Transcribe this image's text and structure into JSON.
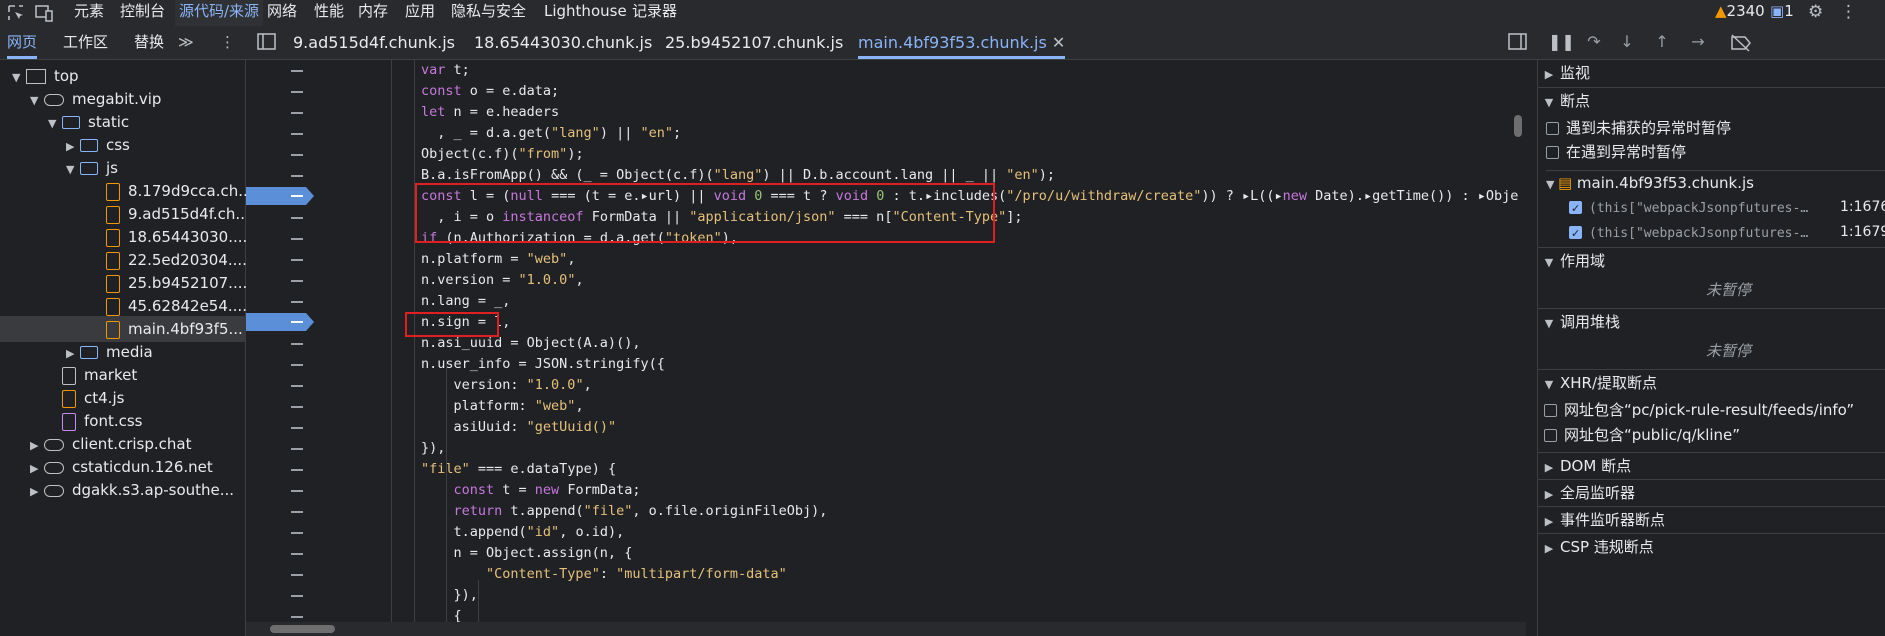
{
  "topbar": {
    "tabs": [
      "元素",
      "控制台",
      "源代码/来源",
      "网络",
      "性能",
      "内存",
      "应用",
      "隐私与安全",
      "Lighthouse",
      "记录器"
    ],
    "issues_count": "2340",
    "messages_count": "1"
  },
  "navigator": {
    "tabs": [
      "网页",
      "工作区",
      "替换"
    ],
    "more": "≫",
    "menu": "⋮"
  },
  "editor_tabs": [
    "9.ad515d4f.chunk.js",
    "18.65443030.chunk.js",
    "25.b9452107.chunk.js",
    "main.4bf93f53.chunk.js"
  ],
  "tree": [
    {
      "label": "top",
      "type": "frame",
      "arrow": "▼"
    },
    {
      "label": "megabit.vip",
      "type": "cloud",
      "arrow": "▼"
    },
    {
      "label": "static",
      "type": "folder",
      "arrow": "▼"
    },
    {
      "label": "css",
      "type": "folder",
      "arrow": "▶"
    },
    {
      "label": "js",
      "type": "folder",
      "arrow": "▼"
    },
    {
      "label": "8.179d9cca.ch...",
      "type": "file"
    },
    {
      "label": "9.ad515d4f.ch...",
      "type": "file"
    },
    {
      "label": "18.65443030....",
      "type": "file"
    },
    {
      "label": "22.5ed20304....",
      "type": "file"
    },
    {
      "label": "25.b9452107....",
      "type": "file"
    },
    {
      "label": "45.62842e54....",
      "type": "file"
    },
    {
      "label": "main.4bf93f5...",
      "type": "file"
    },
    {
      "label": "media",
      "type": "folder",
      "arrow": "▶"
    },
    {
      "label": "market",
      "type": "filegray"
    },
    {
      "label": "ct4.js",
      "type": "file"
    },
    {
      "label": "font.css",
      "type": "css"
    },
    {
      "label": "client.crisp.chat",
      "type": "cloud",
      "arrow": "▶"
    },
    {
      "label": "cstaticdun.126.net",
      "type": "cloud",
      "arrow": "▶"
    },
    {
      "label": "dgakk.s3.ap-southe...",
      "type": "cloud",
      "arrow": "▶"
    }
  ],
  "code_lines": [
    "var t;",
    "const o = e.data;",
    "let n = e.headers",
    "  , _ = d.a.get(\"lang\") || \"en\";",
    "Object(c.f)(\"from\");",
    "B.a.isFromApp() && (_ = Object(c.f)(\"lang\") || D.b.account.lang || _ || \"en\");",
    "const l = (null === (t = e.▸url) || void 0 === t ? void 0 : t.▸includes(\"/pro/u/withdraw/create\")) ? ▸L((▸new Date).▸getTime()) : ▸Obje",
    "  , i = o instanceof FormData || \"application/json\" === n[\"Content-Type\"];",
    "if (n.Authorization = d.a.get(\"token\"),",
    "n.platform = \"web\",",
    "n.version = \"1.0.0\",",
    "n.lang = _,",
    "n.sign = l,",
    "n.asi_uuid = Object(A.a)(),",
    "n.user_info = JSON.stringify({",
    "    version: \"1.0.0\",",
    "    platform: \"web\",",
    "    asiUuid: \"getUuid()\"",
    "}),",
    "\"file\" === e.dataType) {",
    "    const t = new FormData;",
    "    return t.append(\"file\", o.file.originFileObj),",
    "    t.append(\"id\", o.id),",
    "    n = Object.assign(n, {",
    "        \"Content-Type\": \"multipart/form-data\"",
    "    }),",
    "    {"
  ],
  "debugger": {
    "watch": "监视",
    "breakpoints": "断点",
    "pause_uncaught": "遇到未捕获的异常时暂停",
    "pause_caught": "在遇到异常时暂停",
    "bp_file": "main.4bf93f53.chunk.js",
    "bp_items": [
      {
        "code": "(this[\"webpackJsonpfutures-…",
        "line": "1:1676"
      },
      {
        "code": "(this[\"webpackJsonpfutures-…",
        "line": "1:1679"
      }
    ],
    "scope": "作用域",
    "scope_status": "未暂停",
    "callstack": "调用堆栈",
    "callstack_status": "未暂停",
    "xhr": "XHR/提取断点",
    "xhr_items": [
      "网址包含“pc/pick-rule-result/feeds/info”",
      "网址包含“public/q/kline”"
    ],
    "dom": "DOM 断点",
    "global": "全局监听器",
    "event": "事件监听器断点",
    "csp": "CSP 违规断点"
  }
}
